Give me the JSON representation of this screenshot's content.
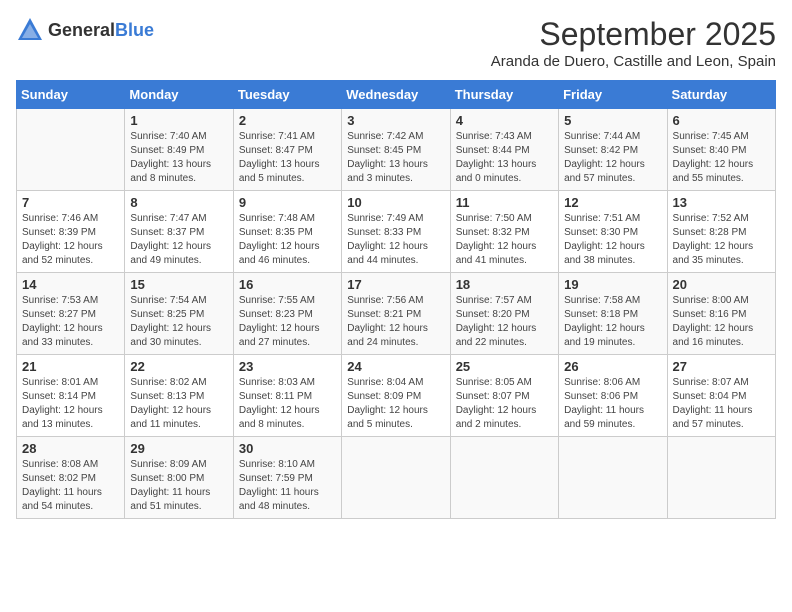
{
  "header": {
    "logo_general": "General",
    "logo_blue": "Blue",
    "month_year": "September 2025",
    "location": "Aranda de Duero, Castille and Leon, Spain"
  },
  "days_of_week": [
    "Sunday",
    "Monday",
    "Tuesday",
    "Wednesday",
    "Thursday",
    "Friday",
    "Saturday"
  ],
  "weeks": [
    [
      {
        "day": "",
        "sunrise": "",
        "sunset": "",
        "daylight": ""
      },
      {
        "day": "1",
        "sunrise": "Sunrise: 7:40 AM",
        "sunset": "Sunset: 8:49 PM",
        "daylight": "Daylight: 13 hours and 8 minutes."
      },
      {
        "day": "2",
        "sunrise": "Sunrise: 7:41 AM",
        "sunset": "Sunset: 8:47 PM",
        "daylight": "Daylight: 13 hours and 5 minutes."
      },
      {
        "day": "3",
        "sunrise": "Sunrise: 7:42 AM",
        "sunset": "Sunset: 8:45 PM",
        "daylight": "Daylight: 13 hours and 3 minutes."
      },
      {
        "day": "4",
        "sunrise": "Sunrise: 7:43 AM",
        "sunset": "Sunset: 8:44 PM",
        "daylight": "Daylight: 13 hours and 0 minutes."
      },
      {
        "day": "5",
        "sunrise": "Sunrise: 7:44 AM",
        "sunset": "Sunset: 8:42 PM",
        "daylight": "Daylight: 12 hours and 57 minutes."
      },
      {
        "day": "6",
        "sunrise": "Sunrise: 7:45 AM",
        "sunset": "Sunset: 8:40 PM",
        "daylight": "Daylight: 12 hours and 55 minutes."
      }
    ],
    [
      {
        "day": "7",
        "sunrise": "Sunrise: 7:46 AM",
        "sunset": "Sunset: 8:39 PM",
        "daylight": "Daylight: 12 hours and 52 minutes."
      },
      {
        "day": "8",
        "sunrise": "Sunrise: 7:47 AM",
        "sunset": "Sunset: 8:37 PM",
        "daylight": "Daylight: 12 hours and 49 minutes."
      },
      {
        "day": "9",
        "sunrise": "Sunrise: 7:48 AM",
        "sunset": "Sunset: 8:35 PM",
        "daylight": "Daylight: 12 hours and 46 minutes."
      },
      {
        "day": "10",
        "sunrise": "Sunrise: 7:49 AM",
        "sunset": "Sunset: 8:33 PM",
        "daylight": "Daylight: 12 hours and 44 minutes."
      },
      {
        "day": "11",
        "sunrise": "Sunrise: 7:50 AM",
        "sunset": "Sunset: 8:32 PM",
        "daylight": "Daylight: 12 hours and 41 minutes."
      },
      {
        "day": "12",
        "sunrise": "Sunrise: 7:51 AM",
        "sunset": "Sunset: 8:30 PM",
        "daylight": "Daylight: 12 hours and 38 minutes."
      },
      {
        "day": "13",
        "sunrise": "Sunrise: 7:52 AM",
        "sunset": "Sunset: 8:28 PM",
        "daylight": "Daylight: 12 hours and 35 minutes."
      }
    ],
    [
      {
        "day": "14",
        "sunrise": "Sunrise: 7:53 AM",
        "sunset": "Sunset: 8:27 PM",
        "daylight": "Daylight: 12 hours and 33 minutes."
      },
      {
        "day": "15",
        "sunrise": "Sunrise: 7:54 AM",
        "sunset": "Sunset: 8:25 PM",
        "daylight": "Daylight: 12 hours and 30 minutes."
      },
      {
        "day": "16",
        "sunrise": "Sunrise: 7:55 AM",
        "sunset": "Sunset: 8:23 PM",
        "daylight": "Daylight: 12 hours and 27 minutes."
      },
      {
        "day": "17",
        "sunrise": "Sunrise: 7:56 AM",
        "sunset": "Sunset: 8:21 PM",
        "daylight": "Daylight: 12 hours and 24 minutes."
      },
      {
        "day": "18",
        "sunrise": "Sunrise: 7:57 AM",
        "sunset": "Sunset: 8:20 PM",
        "daylight": "Daylight: 12 hours and 22 minutes."
      },
      {
        "day": "19",
        "sunrise": "Sunrise: 7:58 AM",
        "sunset": "Sunset: 8:18 PM",
        "daylight": "Daylight: 12 hours and 19 minutes."
      },
      {
        "day": "20",
        "sunrise": "Sunrise: 8:00 AM",
        "sunset": "Sunset: 8:16 PM",
        "daylight": "Daylight: 12 hours and 16 minutes."
      }
    ],
    [
      {
        "day": "21",
        "sunrise": "Sunrise: 8:01 AM",
        "sunset": "Sunset: 8:14 PM",
        "daylight": "Daylight: 12 hours and 13 minutes."
      },
      {
        "day": "22",
        "sunrise": "Sunrise: 8:02 AM",
        "sunset": "Sunset: 8:13 PM",
        "daylight": "Daylight: 12 hours and 11 minutes."
      },
      {
        "day": "23",
        "sunrise": "Sunrise: 8:03 AM",
        "sunset": "Sunset: 8:11 PM",
        "daylight": "Daylight: 12 hours and 8 minutes."
      },
      {
        "day": "24",
        "sunrise": "Sunrise: 8:04 AM",
        "sunset": "Sunset: 8:09 PM",
        "daylight": "Daylight: 12 hours and 5 minutes."
      },
      {
        "day": "25",
        "sunrise": "Sunrise: 8:05 AM",
        "sunset": "Sunset: 8:07 PM",
        "daylight": "Daylight: 12 hours and 2 minutes."
      },
      {
        "day": "26",
        "sunrise": "Sunrise: 8:06 AM",
        "sunset": "Sunset: 8:06 PM",
        "daylight": "Daylight: 11 hours and 59 minutes."
      },
      {
        "day": "27",
        "sunrise": "Sunrise: 8:07 AM",
        "sunset": "Sunset: 8:04 PM",
        "daylight": "Daylight: 11 hours and 57 minutes."
      }
    ],
    [
      {
        "day": "28",
        "sunrise": "Sunrise: 8:08 AM",
        "sunset": "Sunset: 8:02 PM",
        "daylight": "Daylight: 11 hours and 54 minutes."
      },
      {
        "day": "29",
        "sunrise": "Sunrise: 8:09 AM",
        "sunset": "Sunset: 8:00 PM",
        "daylight": "Daylight: 11 hours and 51 minutes."
      },
      {
        "day": "30",
        "sunrise": "Sunrise: 8:10 AM",
        "sunset": "Sunset: 7:59 PM",
        "daylight": "Daylight: 11 hours and 48 minutes."
      },
      {
        "day": "",
        "sunrise": "",
        "sunset": "",
        "daylight": ""
      },
      {
        "day": "",
        "sunrise": "",
        "sunset": "",
        "daylight": ""
      },
      {
        "day": "",
        "sunrise": "",
        "sunset": "",
        "daylight": ""
      },
      {
        "day": "",
        "sunrise": "",
        "sunset": "",
        "daylight": ""
      }
    ]
  ]
}
